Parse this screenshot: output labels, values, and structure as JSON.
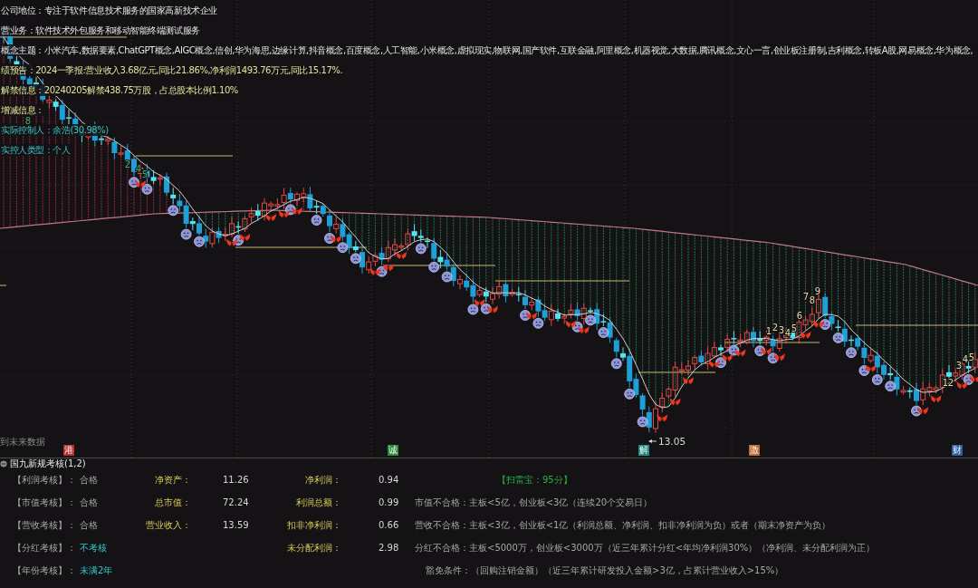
{
  "chart": {
    "info_lines": [
      {
        "label": "公司地位：",
        "value": "专注于软件信息技术服务的国家高新技术企业",
        "kind": "profile"
      },
      {
        "label": "营业务：",
        "value": "软件技术外包服务和移动智能终端测试服务",
        "kind": "profile"
      },
      {
        "label": "概念主题：",
        "value": "小米汽车,数据要素,ChatGPT概念,AIGC概念,信创,华为海思,边缘计算,抖音概念,百度概念,人工智能,小米概念,虚拟现实,物联网,国产软件,互联金融,阿里概念,机器视觉,大数据,腾讯概念,文心一言,创业板注册制,吉利概念,转板A股,网易概念,华为概念,",
        "kind": "profile"
      },
      {
        "label": "绩预告：",
        "value": "2024一季报:营业收入3.68亿元,同比21.86%,净利润1493.76万元,同比15.17%.",
        "kind": "finance"
      },
      {
        "label": "解禁信息：",
        "value": "20240205解禁438.75万股，占总股本比例1.10%",
        "kind": "finance"
      },
      {
        "label": "增减信息：",
        "kind": "finance"
      },
      {
        "label": "实际控制人：",
        "value": "余浩(30.98%)",
        "kind": "holder"
      },
      {
        "label": "实控人类型：",
        "value": "个人",
        "kind": "holder"
      }
    ],
    "sequence_numbers": [
      "8",
      "2",
      "4",
      "5",
      "1",
      "2",
      "3",
      "4",
      "5",
      "6",
      "7",
      "8",
      "9",
      "1",
      "2",
      "3",
      "4",
      "5"
    ],
    "low_price": "13.05",
    "hint": "到未来数据",
    "event_tags": [
      {
        "label": "港",
        "color": "#b8302c"
      },
      {
        "label": "诚",
        "color": "#2a8a3a"
      },
      {
        "label": "解",
        "color": "#1f8a84"
      },
      {
        "label": "激",
        "color": "#c0662a"
      },
      {
        "label": "财",
        "color": "#2a5f9e"
      }
    ]
  },
  "review": {
    "title": "国九新规考核(1,2)",
    "rows": [
      {
        "check": {
          "label": "【利润考核】：",
          "result": "合格",
          "kind": "pass"
        },
        "metric_a": {
          "label": "净资产：",
          "value": "11.26"
        },
        "metric_b": {
          "label": "净利润：",
          "value": "0.94"
        },
        "note": {
          "text": "【扫雷宝：95分】",
          "kind": "score"
        }
      },
      {
        "check": {
          "label": "【市值考核】：",
          "result": "合格",
          "kind": "pass"
        },
        "metric_a": {
          "label": "总市值：",
          "value": "72.24"
        },
        "metric_b": {
          "label": "利润总额：",
          "value": "0.99"
        },
        "note": {
          "text": "市值不合格：主板<5亿，创业板<3亿（连续20个交易日）",
          "kind": "rule"
        }
      },
      {
        "check": {
          "label": "【营收考核】：",
          "result": "合格",
          "kind": "pass"
        },
        "metric_a": {
          "label": "营业收入：",
          "value": "13.59"
        },
        "metric_b": {
          "label": "扣非净利润：",
          "value": "0.66"
        },
        "note": {
          "text": "营收不合格：主板<3亿，创业板<1亿（利润总额、净利润、扣非净利润为负）或者（期末净资产为负）",
          "kind": "rule"
        }
      },
      {
        "check": {
          "label": "【分红考核】：",
          "result": "不考核",
          "kind": "exempt"
        },
        "metric_b": {
          "label": "未分配利润：",
          "value": "2.98"
        },
        "note": {
          "text": "分红不合格：主板<5000万，创业板<3000万（近三年累计分红<年均净利润30%）（净利润、未分配利润为正）",
          "kind": "rule"
        }
      },
      {
        "check": {
          "label": "【年份考核】：",
          "result": "未满2年",
          "kind": "exempt"
        },
        "note": {
          "text": "豁免条件：（回购注销金额）（近三年累计研发投入金额>3亿，占累计营业收入>15%）",
          "kind": "exemption"
        }
      }
    ]
  }
}
